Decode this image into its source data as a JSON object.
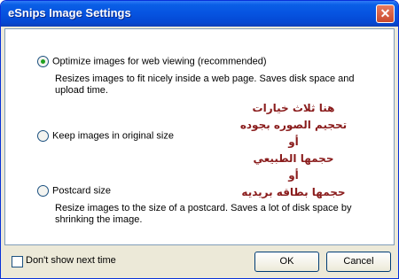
{
  "window": {
    "title": "eSnips Image Settings"
  },
  "options": [
    {
      "label": "Optimize images for web viewing (recommended)",
      "selected": true,
      "description": "Resizes images to fit nicely inside a web page. Saves disk space and upload time."
    },
    {
      "label": "Keep images in original size",
      "selected": false,
      "description": ""
    },
    {
      "label": "Postcard size",
      "selected": false,
      "description": "Resize images to the size of a postcard. Saves a lot of disk space by shrinking the image."
    }
  ],
  "annotation": [
    "هنا ثلاث خيارات",
    "تحجيم الصوره بجوده",
    "أو",
    "حجمها الطبيعي",
    "أو",
    "حجمها بطاقه بريديه"
  ],
  "footer": {
    "dont_show_label": "Don't show next time",
    "dont_show_checked": false,
    "ok_label": "OK",
    "cancel_label": "Cancel"
  },
  "colors": {
    "titlebar": "#0653e0",
    "annotation": "#8a1c1c"
  }
}
